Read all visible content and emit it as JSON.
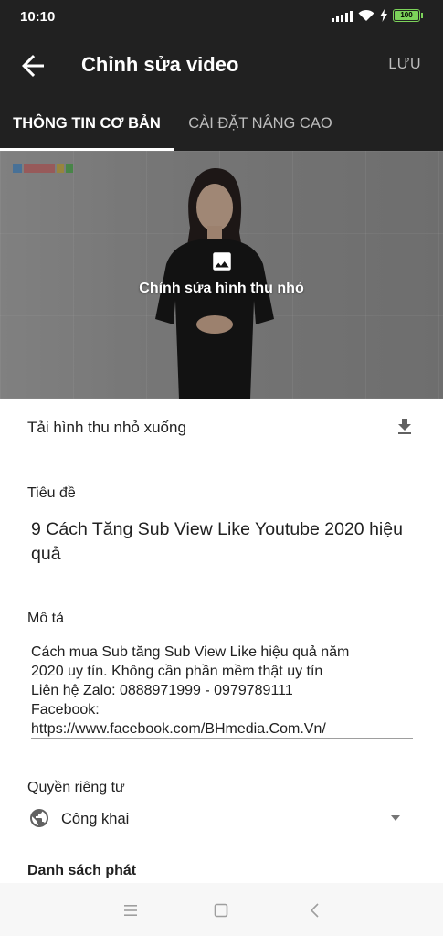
{
  "status_bar": {
    "time": "10:10",
    "battery": "100"
  },
  "app_bar": {
    "title": "Chỉnh sửa video",
    "save_label": "LƯU"
  },
  "tabs": [
    {
      "label": "THÔNG TIN CƠ BẢN",
      "selected": true
    },
    {
      "label": "CÀI ĐẶT NÂNG CAO",
      "selected": false
    }
  ],
  "thumbnail": {
    "edit_label": "Chỉnh sửa hình thu nhỏ"
  },
  "download": {
    "label": "Tải hình thu nhỏ xuống"
  },
  "title_field": {
    "label": "Tiêu đề",
    "value": "9 Cách Tăng Sub View Like Youtube 2020 hiệu quả"
  },
  "description_field": {
    "label": "Mô tả",
    "lines": [
      "Cách mua Sub tăng Sub View Like hiệu quả năm",
      "2020 uy tín. Không cần phần mềm thật uy tín",
      "Liên hệ Zalo: 0888971999 - 0979789111",
      "Facebook:",
      "https://www.facebook.com/BHmedia.Com.Vn/"
    ]
  },
  "privacy_field": {
    "label": "Quyền riêng tư",
    "value": "Công khai"
  },
  "playlist_field": {
    "label": "Danh sách phát"
  },
  "colors": {
    "app_bar": "#212121",
    "battery": "#7cd35a",
    "divider": "#9e9e9e"
  }
}
